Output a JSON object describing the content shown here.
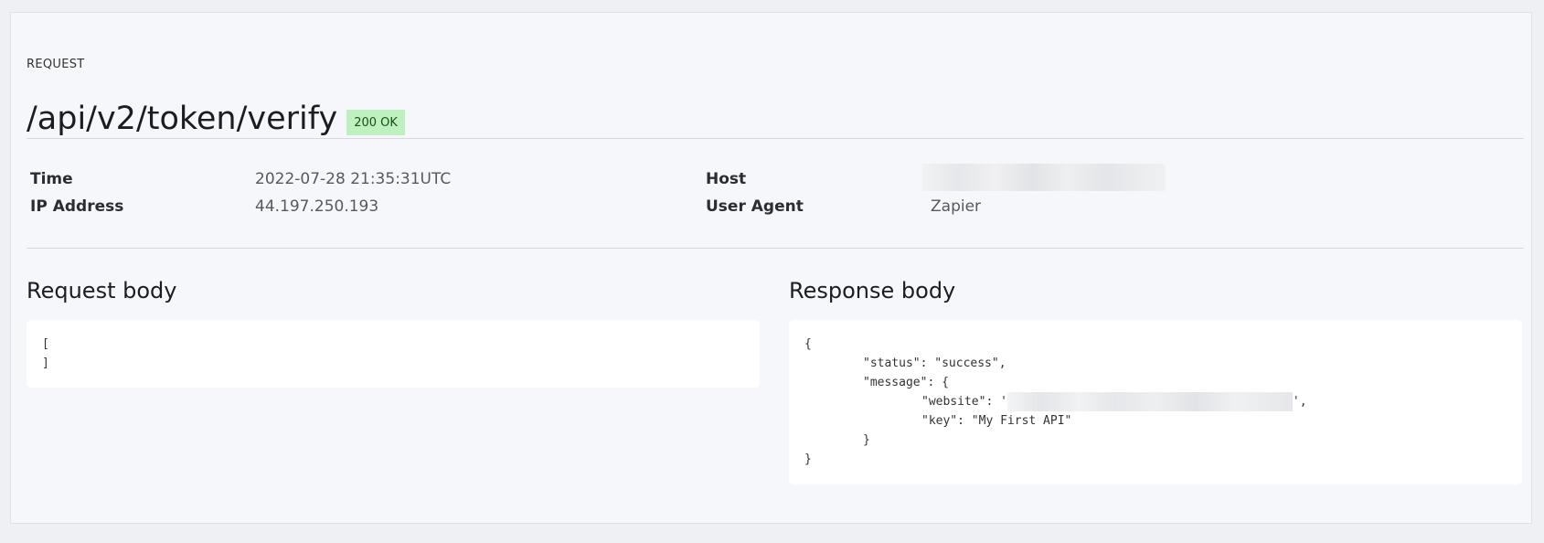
{
  "request": {
    "section_label": "REQUEST",
    "endpoint": "/api/v2/token/verify",
    "status": "200 OK"
  },
  "meta": {
    "time_label": "Time",
    "time_value": "2022-07-28 21:35:31UTC",
    "ip_label": "IP Address",
    "ip_value": "44.197.250.193",
    "host_label": "Host",
    "host_value_redacted": true,
    "user_agent_label": "User Agent",
    "user_agent_value": "Zapier"
  },
  "request_body": {
    "heading": "Request body",
    "lines": [
      "[",
      "]"
    ]
  },
  "response_body": {
    "heading": "Response body",
    "line1": "{",
    "line2": "\"status\": \"success\",",
    "line3": "\"message\": {",
    "line4_prefix": "\"website\": '",
    "line4_suffix": "',",
    "line5": "\"key\": \"My First API\"",
    "line6": "}",
    "line7": "}"
  },
  "colors": {
    "status_badge_bg": "#bff0bf",
    "status_badge_text": "#145214",
    "panel_bg": "#f6f7fa"
  }
}
